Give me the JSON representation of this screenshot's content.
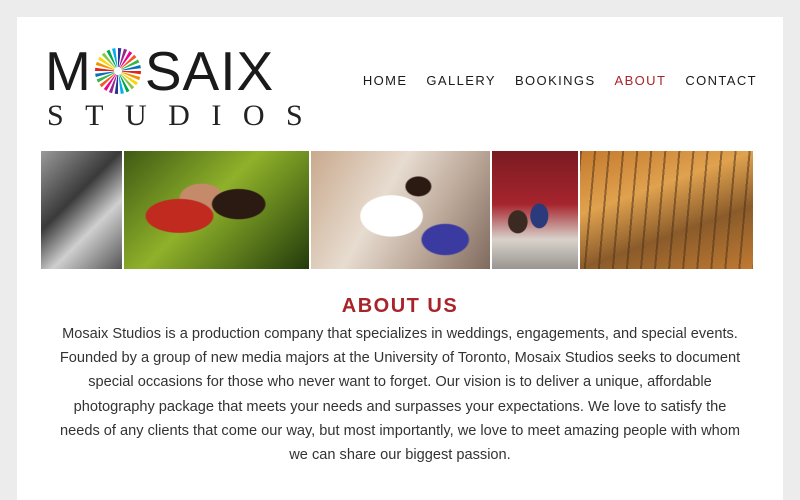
{
  "brand": {
    "logo_letter_m": "M",
    "logo_rest": "SAIX",
    "logo_sub": "STUDIOS"
  },
  "nav": {
    "items": [
      {
        "label": "HOME",
        "active": false
      },
      {
        "label": "GALLERY",
        "active": false
      },
      {
        "label": "BOOKINGS",
        "active": false
      },
      {
        "label": "ABOUT",
        "active": true
      },
      {
        "label": "CONTACT",
        "active": false
      }
    ]
  },
  "gallery": {
    "photos": [
      {
        "alt": "black-and-white couple photo"
      },
      {
        "alt": "couple kissing in garden"
      },
      {
        "alt": "bride and bridesmaid"
      },
      {
        "alt": "couple walking in autumn"
      },
      {
        "alt": "autumn forest with couple"
      }
    ]
  },
  "about": {
    "title": "ABOUT US",
    "body": "Mosaix Studios is a production company that specializes in weddings, engagements, and special events. Founded by a group of new media majors at the University of Toronto, Mosaix Studios seeks to document special occasions for those who never want to forget.  Our vision is to deliver a unique, affordable photography package that meets your needs and surpasses your expectations. We love to satisfy the needs of any clients that come our way, but most importantly, we love to meet amazing people with whom we can share our biggest passion."
  },
  "colors": {
    "accent": "#a8242a",
    "background": "#ececec",
    "panel": "#ffffff"
  }
}
